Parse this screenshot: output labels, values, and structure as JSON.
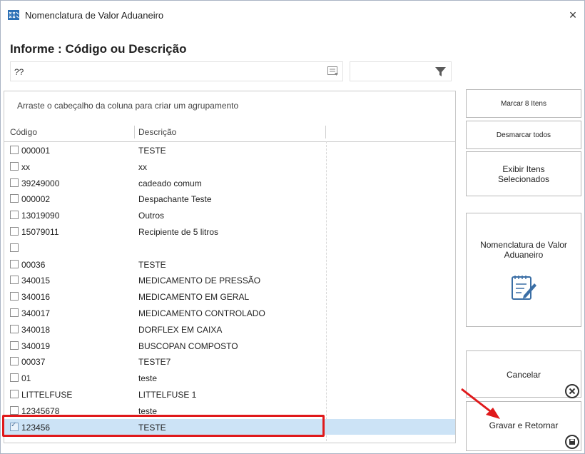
{
  "window": {
    "title": "Nomenclatura de Valor Aduaneiro",
    "close_label": "×"
  },
  "search": {
    "prompt": "Informe : Código ou Descrição",
    "value": "??",
    "filter_value": ""
  },
  "grid": {
    "group_hint": "Arraste o cabeçalho da coluna para criar um agrupamento",
    "columns": [
      "Código",
      "Descrição"
    ],
    "rows": [
      {
        "code": "000001",
        "desc": "TESTE",
        "checked": false
      },
      {
        "code": "xx",
        "desc": "xx",
        "checked": false
      },
      {
        "code": "39249000",
        "desc": "cadeado comum",
        "checked": false
      },
      {
        "code": "000002",
        "desc": "Despachante Teste",
        "checked": false
      },
      {
        "code": "13019090",
        "desc": "Outros",
        "checked": false
      },
      {
        "code": "15079011",
        "desc": "Recipiente de 5 litros",
        "checked": false
      },
      {
        "code": "",
        "desc": "",
        "checked": false
      },
      {
        "code": "00036",
        "desc": "TESTE",
        "checked": false
      },
      {
        "code": "340015",
        "desc": "MEDICAMENTO DE PRESSÃO",
        "checked": false
      },
      {
        "code": "340016",
        "desc": "MEDICAMENTO EM GERAL",
        "checked": false
      },
      {
        "code": "340017",
        "desc": "MEDICAMENTO CONTROLADO",
        "checked": false
      },
      {
        "code": "340018",
        "desc": "DORFLEX EM CAIXA",
        "checked": false
      },
      {
        "code": "340019",
        "desc": "BUSCOPAN COMPOSTO",
        "checked": false
      },
      {
        "code": "00037",
        "desc": "TESTE7",
        "checked": false
      },
      {
        "code": "01",
        "desc": "teste",
        "checked": false
      },
      {
        "code": "LITTELFUSE",
        "desc": "LITTELFUSE 1",
        "checked": false
      },
      {
        "code": "12345678",
        "desc": "teste",
        "checked": false
      },
      {
        "code": "123456",
        "desc": "TESTE",
        "checked": true
      }
    ]
  },
  "buttons": {
    "mark_items": "Marcar 8 Itens",
    "unmark_all": "Desmarcar todos",
    "show_selected_line1": "Exibir Itens",
    "show_selected_line2": "Selecionados",
    "nomenclature_line1": "Nomenclatura de Valor",
    "nomenclature_line2": "Aduaneiro",
    "cancel": "Cancelar",
    "save_return": "Gravar e Retornar"
  },
  "colors": {
    "highlight_border": "#e0191b",
    "selected_row": "#cce3f6",
    "accent": "#2a6fb5"
  }
}
